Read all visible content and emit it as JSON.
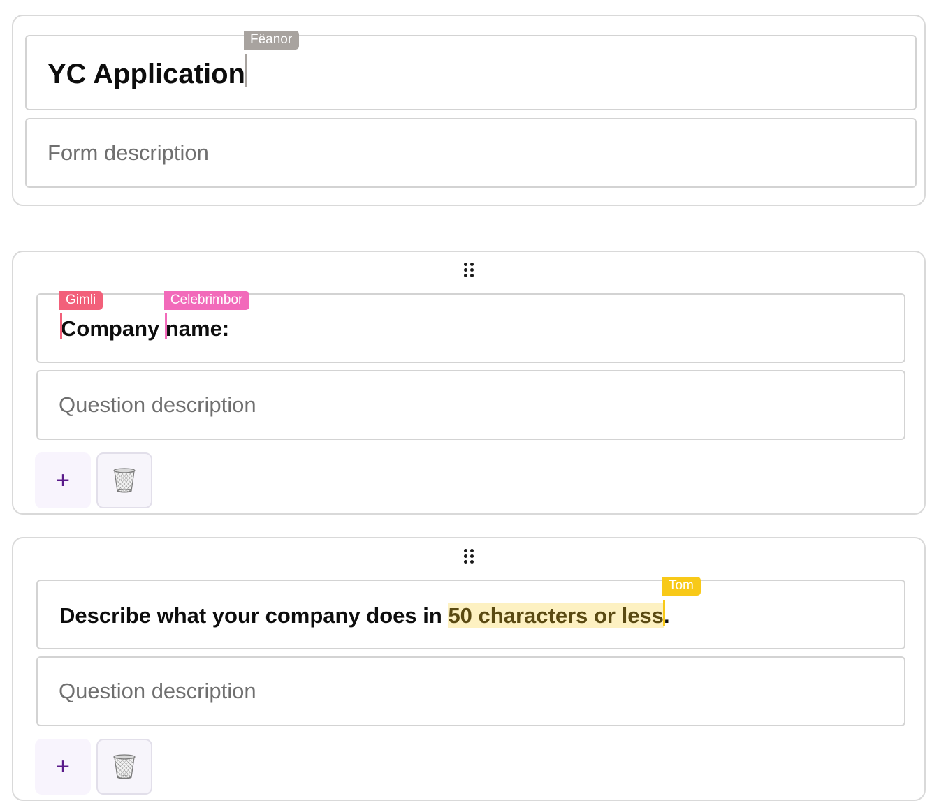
{
  "form_header": {
    "title": "YC Application",
    "description_placeholder": "Form description",
    "title_cursor": {
      "user": "Fëanor",
      "color": "#a8a39f"
    }
  },
  "questions": [
    {
      "title_part_1": "C",
      "title_part_2": "ompany ",
      "title_part_3": "name:",
      "cursors": [
        {
          "user": "Gimli",
          "color": "#f2607a"
        },
        {
          "user": "Celebrimbor",
          "color": "#f26aba"
        }
      ],
      "description_placeholder": "Question description"
    },
    {
      "title_plain": "Describe what your company does in ",
      "title_highlight": "50 characters or less",
      "title_end": ".",
      "cursors": [
        {
          "user": "Tom",
          "color": "#f8c918"
        }
      ],
      "highlight_color": "#fdf1c2",
      "description_placeholder": "Question description"
    }
  ],
  "icons": {
    "add": "+",
    "drag": "drag-handle-icon",
    "trash": "trash-icon"
  }
}
